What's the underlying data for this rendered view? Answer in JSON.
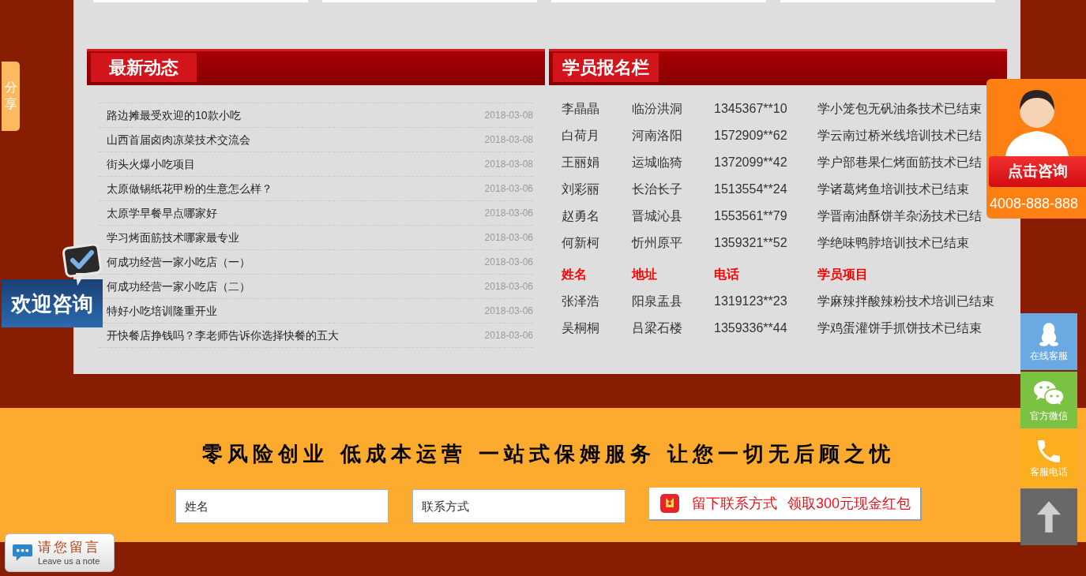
{
  "share_tab": {
    "label": "分享"
  },
  "news": {
    "title": "最新动态",
    "items": [
      {
        "title": "路边摊最受欢迎的10款小吃",
        "date": "2018-03-08"
      },
      {
        "title": "山西首届卤肉凉菜技术交流会",
        "date": "2018-03-08"
      },
      {
        "title": "街头火爆小吃项目",
        "date": "2018-03-08"
      },
      {
        "title": "太原做锡纸花甲粉的生意怎么样？",
        "date": "2018-03-06"
      },
      {
        "title": "太原学早餐早点哪家好",
        "date": "2018-03-06"
      },
      {
        "title": "学习烤面筋技术哪家最专业",
        "date": "2018-03-06"
      },
      {
        "title": "何成功经营一家小吃店（一）",
        "date": "2018-03-06"
      },
      {
        "title": "何成功经营一家小吃店（二）",
        "date": "2018-03-06"
      },
      {
        "title": "特好小吃培训隆重开业",
        "date": "2018-03-06"
      },
      {
        "title": "开快餐店挣钱吗？李老师告诉你选择快餐的五大",
        "date": "2018-03-06"
      }
    ]
  },
  "signup": {
    "title": "学员报名栏",
    "rows": [
      {
        "kind": "entry",
        "cells": [
          "李晶晶",
          "临汾洪洞",
          "1345367**10",
          "学小笼包无矾油条技术已结束"
        ]
      },
      {
        "kind": "entry",
        "cells": [
          "白荷月",
          "河南洛阳",
          "1572909**62",
          "学云南过桥米线培训技术已结"
        ]
      },
      {
        "kind": "entry",
        "cells": [
          "王丽娟",
          "运城临猗",
          "1372099**42",
          "学户部巷果仁烤面筋技术已结"
        ]
      },
      {
        "kind": "entry",
        "cells": [
          "刘彩丽",
          "长治长子",
          "1513554**24",
          "学诸葛烤鱼培训技术已结束"
        ]
      },
      {
        "kind": "entry",
        "cells": [
          "赵勇名",
          "晋城沁县",
          "1553561**79",
          "学晋南油酥饼羊杂汤技术已结"
        ]
      },
      {
        "kind": "entry",
        "cells": [
          "何新柯",
          "忻州原平",
          "1359321**52",
          "学绝味鸭脖培训技术已结束"
        ]
      },
      {
        "kind": "header",
        "cells": [
          "姓名",
          "地址",
          "电话",
          "学员项目"
        ]
      },
      {
        "kind": "entry",
        "cells": [
          "张泽浩",
          "阳泉盂县",
          "1319123**23",
          "学麻辣拌酸辣粉技术培训已结束"
        ]
      },
      {
        "kind": "entry",
        "cells": [
          "吴桐桐",
          "吕梁石楼",
          "1359336**44",
          "学鸡蛋灌饼手抓饼技术已结束"
        ]
      }
    ]
  },
  "welcome_badge": {
    "label": "欢迎咨询"
  },
  "consult_widget": {
    "button": "点击咨询",
    "phone": "4008-888-888"
  },
  "side_buttons": [
    {
      "kind": "qq",
      "label": "在线客服",
      "color": "#6aa9e1"
    },
    {
      "kind": "wechat",
      "label": "官方微信",
      "color": "#7cc242"
    },
    {
      "kind": "phone",
      "label": "客服电话",
      "color": "#fbae1f"
    },
    {
      "kind": "top",
      "color": "#686868"
    }
  ],
  "cta": {
    "slogan": "零风险创业 低成本运营 一站式保姆服务 让您一切无后顾之忧",
    "fields": [
      {
        "placeholder": "姓名"
      },
      {
        "placeholder": "联系方式"
      }
    ],
    "button": "留下联系方式 领取300元现金红包"
  },
  "leave_note": {
    "title": "请您留言",
    "subtitle": "Leave us a note"
  }
}
